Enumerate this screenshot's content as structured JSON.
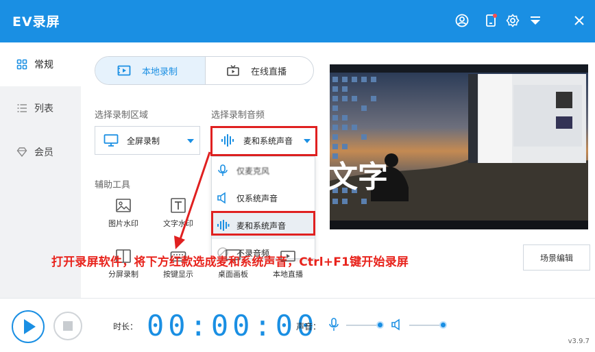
{
  "app": {
    "title": "EV录屏",
    "version": "v3.9.7"
  },
  "titlebar": {
    "icons": [
      "user-icon",
      "notification-icon",
      "settings-icon",
      "menu-dropdown-icon",
      "close-icon"
    ]
  },
  "sidebar": {
    "items": [
      {
        "label": "常规",
        "icon": "grid-icon",
        "active": true
      },
      {
        "label": "列表",
        "icon": "list-icon",
        "active": false
      },
      {
        "label": "会员",
        "icon": "diamond-icon",
        "active": false
      }
    ]
  },
  "mode_tabs": [
    {
      "label": "本地录制",
      "icon": "local-record-icon",
      "active": true
    },
    {
      "label": "在线直播",
      "icon": "live-tv-icon",
      "active": false
    }
  ],
  "record_area": {
    "label": "选择录制区域",
    "value": "全屏录制"
  },
  "record_audio": {
    "label": "选择录制音频",
    "value": "麦和系统声音",
    "options": [
      {
        "label": "仅麦克风",
        "icon": "mic-icon",
        "selected": false
      },
      {
        "label": "仅系统声音",
        "icon": "speaker-icon",
        "selected": false
      },
      {
        "label": "麦和系统声音",
        "icon": "waveform-icon",
        "selected": true
      },
      {
        "label": "不录音频",
        "icon": "mute-icon",
        "selected": false
      }
    ]
  },
  "tools": {
    "label": "辅助工具",
    "items": [
      {
        "label": "图片水印",
        "icon": "image-watermark-icon"
      },
      {
        "label": "文字水印",
        "icon": "text-watermark-icon"
      },
      {
        "label": "分屏录制",
        "icon": "split-screen-icon"
      },
      {
        "label": "按键显示",
        "icon": "keyboard-icon"
      },
      {
        "label": "桌面画板",
        "icon": "desktop-board-icon"
      },
      {
        "label": "本地直播",
        "icon": "local-live-icon"
      }
    ]
  },
  "preview": {
    "overlay_text": "文字"
  },
  "scene_edit_label": "场景编辑",
  "annotation": "打开录屏软件，将下方红款选成麦和系统声音，Ctrl+F1键开始录屏",
  "bottom": {
    "duration_label": "时长：",
    "timer": "00:00:00",
    "volume_label": "声音：",
    "mic_volume": 1.0,
    "system_volume": 1.0
  },
  "colors": {
    "accent": "#1a8fe3",
    "highlight_red": "#e02020",
    "annotation_red": "#e8231c"
  }
}
